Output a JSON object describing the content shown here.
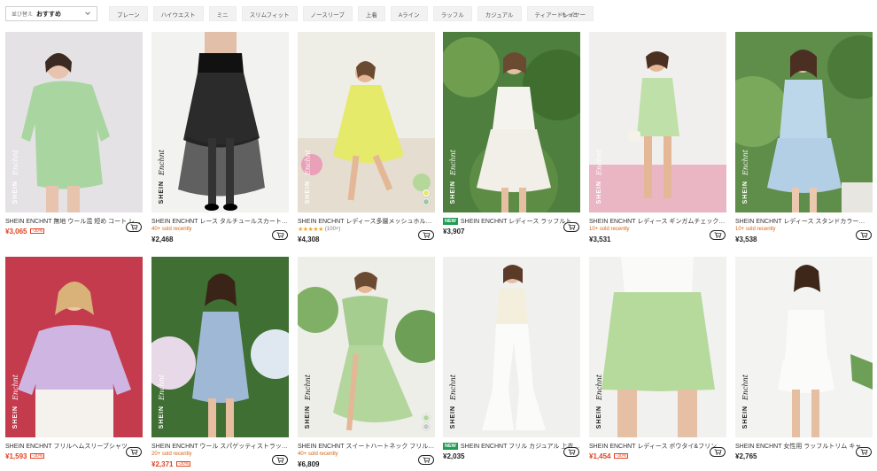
{
  "sort": {
    "label": "並び替え",
    "value": "おすすめ"
  },
  "filters": [
    "プレーン",
    "ハイウエスト",
    "ミニ",
    "スリムフィット",
    "ノースリーブ",
    "上着",
    "Aライン",
    "ラッフル",
    "カジュアル",
    "ティアードレイヤー"
  ],
  "more_label": "もっと",
  "brand": {
    "text": "SHEIN",
    "script": "Enchnt"
  },
  "products": [
    {
      "title": "SHEIN ENCHNT 無地 ウール混 短め コート レ…",
      "price": "¥3,065",
      "discount": "-30%",
      "sold": "",
      "rating": "",
      "new": ""
    },
    {
      "title": "SHEIN ENCHNT レース タルチュールスカート…",
      "price": "¥2,468",
      "discount": "",
      "sold": "40+ sold recently",
      "rating": "",
      "new": ""
    },
    {
      "title": "SHEIN ENCHNT レディース多層メッシュホル…",
      "price": "¥4,308",
      "discount": "",
      "sold": "",
      "rating": "(100+)",
      "new": ""
    },
    {
      "title": "SHEIN ENCHNT レディース ラッフルト…",
      "price": "¥3,907",
      "discount": "",
      "sold": "",
      "rating": "",
      "new": "NEW"
    },
    {
      "title": "SHEIN ENCHNT レディース ギンガムチェック…",
      "price": "¥3,531",
      "discount": "",
      "sold": "10+ sold recently",
      "rating": "",
      "new": ""
    },
    {
      "title": "SHEIN ENCHNT レディース スタンドカラー…",
      "price": "¥3,538",
      "discount": "",
      "sold": "10+ sold recently",
      "rating": "",
      "new": ""
    },
    {
      "title": "SHEIN ENCHNT フリルヘムスリーブシャツ",
      "price": "¥1,593",
      "discount": "-30%",
      "sold": "",
      "rating": "",
      "new": ""
    },
    {
      "title": "SHEIN ENCHNT ウール スパゲッティストラップ…",
      "price": "¥2,371",
      "discount": "-30%",
      "sold": "20+ sold recently",
      "rating": "",
      "new": ""
    },
    {
      "title": "SHEIN ENCHNT スイートハートネック フリル…",
      "price": "¥6,809",
      "discount": "",
      "sold": "40+ sold recently",
      "rating": "",
      "new": ""
    },
    {
      "title": "SHEIN ENCHNT フリル カジュアル 上衣…",
      "price": "¥2,035",
      "discount": "",
      "sold": "",
      "rating": "",
      "new": "NEW"
    },
    {
      "title": "SHEIN ENCHNT レディース ボウタイ&フリン…",
      "price": "¥1,454",
      "discount": "-30%",
      "sold": "",
      "rating": "",
      "new": ""
    },
    {
      "title": "SHEIN ENCHNT 女性用 ラッフルトリム キャ…",
      "price": "¥2,765",
      "discount": "",
      "sold": "",
      "rating": "",
      "new": ""
    }
  ],
  "colors": {
    "sale": "#e0421f",
    "sold": "#d6630f",
    "new_badge": "#1f9d55",
    "star": "#f5a623"
  }
}
